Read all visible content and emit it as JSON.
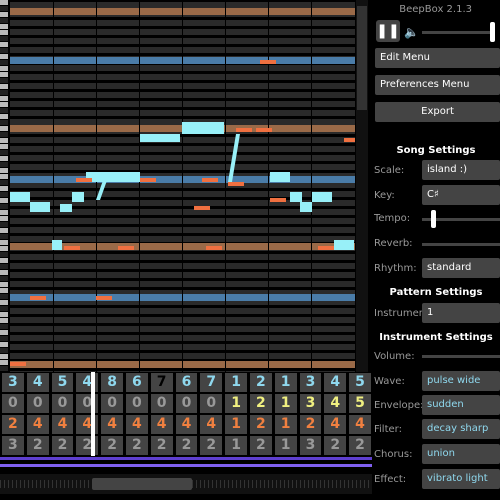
{
  "app": {
    "title": "BeepBox 2.1.3"
  },
  "transport": {
    "play_state": "paused",
    "volume_icon": "speaker-icon"
  },
  "menus": {
    "edit": "Edit Menu",
    "preferences": "Preferences Menu",
    "export": "Export"
  },
  "song_settings": {
    "heading": "Song Settings",
    "scale_label": "Scale:",
    "scale_value": "island :)",
    "key_label": "Key:",
    "key_value": "C♯",
    "tempo_label": "Tempo:",
    "reverb_label": "Reverb:",
    "rhythm_label": "Rhythm:",
    "rhythm_value": "standard"
  },
  "pattern_settings": {
    "heading": "Pattern Settings",
    "instrument_label": "Instrument:",
    "instrument_value": "1"
  },
  "instrument_settings": {
    "heading": "Instrument Settings",
    "volume_label": "Volume:",
    "wave_label": "Wave:",
    "wave_value": "pulse wide",
    "envelope_label": "Envelope:",
    "envelope_value": "sudden",
    "filter_label": "Filter:",
    "filter_value": "decay sharp",
    "chorus_label": "Chorus:",
    "chorus_value": "union",
    "effect_label": "Effect:",
    "effect_value": "vibrato light"
  },
  "pattern_grid": {
    "current_bar": 6,
    "channels": [
      {
        "color": "#8fd8ee",
        "patterns": [
          "3",
          "4",
          "5",
          "4",
          "8",
          "6",
          "7",
          "6",
          "7",
          "1",
          "2",
          "1",
          "3",
          "4",
          "5"
        ]
      },
      {
        "color": "#f0f080",
        "patterns": [
          "0",
          "0",
          "0",
          "0",
          "0",
          "0",
          "0",
          "0",
          "0",
          "1",
          "2",
          "1",
          "3",
          "4",
          "5"
        ]
      },
      {
        "color": "#f08040",
        "patterns": [
          "2",
          "4",
          "4",
          "4",
          "4",
          "4",
          "4",
          "4",
          "4",
          "1",
          "2",
          "1",
          "2",
          "4",
          "4"
        ]
      },
      {
        "color": "#e8e8e8",
        "patterns": [
          "3",
          "2",
          "2",
          "2",
          "2",
          "2",
          "2",
          "2",
          "2",
          "1",
          "2",
          "1",
          "3",
          "2",
          "2"
        ]
      }
    ]
  },
  "colors": {
    "pitch_note": "#98f0f8",
    "drum_note": "#f07040",
    "bar_brown": "#9a6a48",
    "bar_blue": "#4a7ca8",
    "panel_bg": "#000000",
    "control_bg": "#444444"
  }
}
